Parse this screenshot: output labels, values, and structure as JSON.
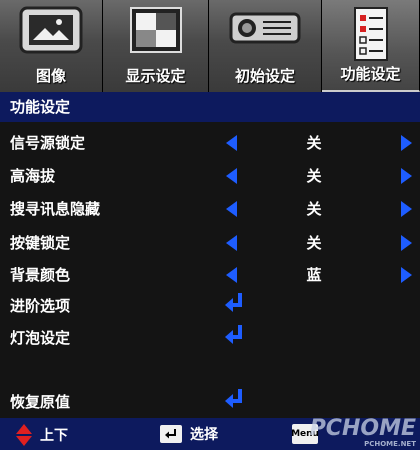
{
  "tabs": [
    {
      "label": "图像",
      "icon": "picture-icon"
    },
    {
      "label": "显示设定",
      "icon": "display-icon"
    },
    {
      "label": "初始设定",
      "icon": "projector-icon"
    },
    {
      "label": "功能设定",
      "icon": "checklist-icon",
      "active": true
    }
  ],
  "section_title": "功能设定",
  "menu": [
    {
      "label": "信号源锁定",
      "value": "关",
      "kind": "option"
    },
    {
      "label": "高海拔",
      "value": "关",
      "kind": "option"
    },
    {
      "label": "搜寻讯息隐藏",
      "value": "关",
      "kind": "option"
    },
    {
      "label": "按键锁定",
      "value": "关",
      "kind": "option"
    },
    {
      "label": "背景颜色",
      "value": "蓝",
      "kind": "option"
    },
    {
      "label": "进阶选项",
      "kind": "submenu"
    },
    {
      "label": "灯泡设定",
      "kind": "submenu"
    },
    {
      "label": "恢复原值",
      "kind": "submenu"
    }
  ],
  "footer": {
    "updown_label": "上下",
    "enter_label": "选择",
    "menu_key": "Menu"
  },
  "watermark": {
    "main": "PCHOME",
    "sub": "PCHOME.NET"
  },
  "colors": {
    "accent_blue": "#1e5dff",
    "header_bg": "#0d1a5e",
    "updown_red": "#e02020"
  }
}
